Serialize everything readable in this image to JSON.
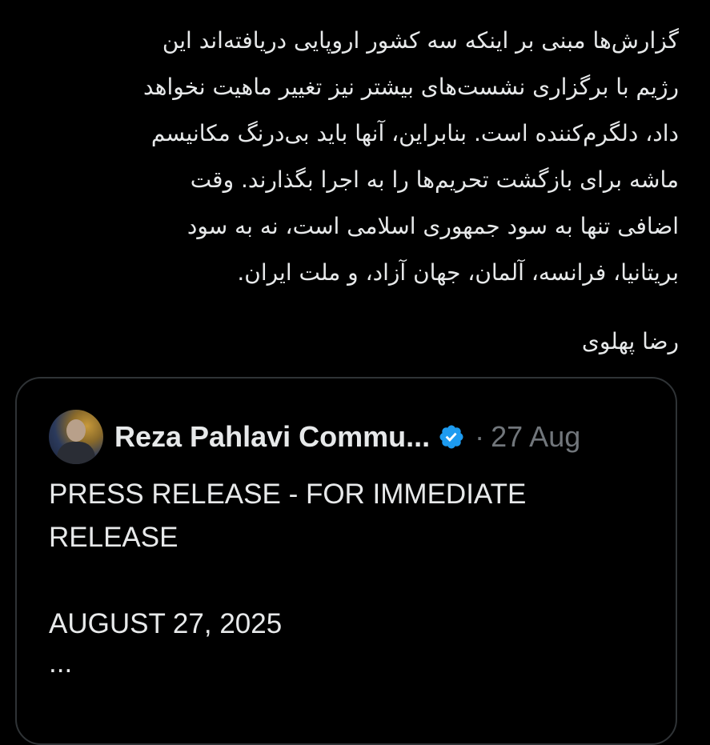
{
  "tweet": {
    "text_lines": [
      "گزارش‌ها مبنی بر اینکه سه کشور اروپایی دریافته‌اند این",
      "رژیم با برگزاری نشست‌های بیشتر نیز تغییر ماهیت نخواهد",
      "داد، دلگرم‌کننده است. بنابراین، آنها باید بی‌درنگ مکانیسم",
      "ماشه برای بازگشت تحریم‌ها را به اجرا بگذارند. وقت",
      "اضافی تنها به سود جمهوری اسلامی است، نه به سود",
      "بریتانیا، فرانسه، آلمان، جهان آزاد، و ملت ایران."
    ],
    "signature": "رضا پهلوی"
  },
  "quoted_tweet": {
    "author_name": "Reza Pahlavi Commu...",
    "separator": "·",
    "date": "27 Aug",
    "body_line_1": "PRESS RELEASE - FOR IMMEDIATE",
    "body_line_2": "RELEASE",
    "body_line_3": "AUGUST 27, 2025",
    "body_line_4": "..."
  },
  "colors": {
    "background": "#000000",
    "text": "#e7e9ea",
    "muted": "#71767b",
    "border": "#2f3336",
    "verified": "#1d9bf0"
  },
  "icons": {
    "verified": "verified-badge-icon",
    "avatar": "profile-avatar"
  }
}
